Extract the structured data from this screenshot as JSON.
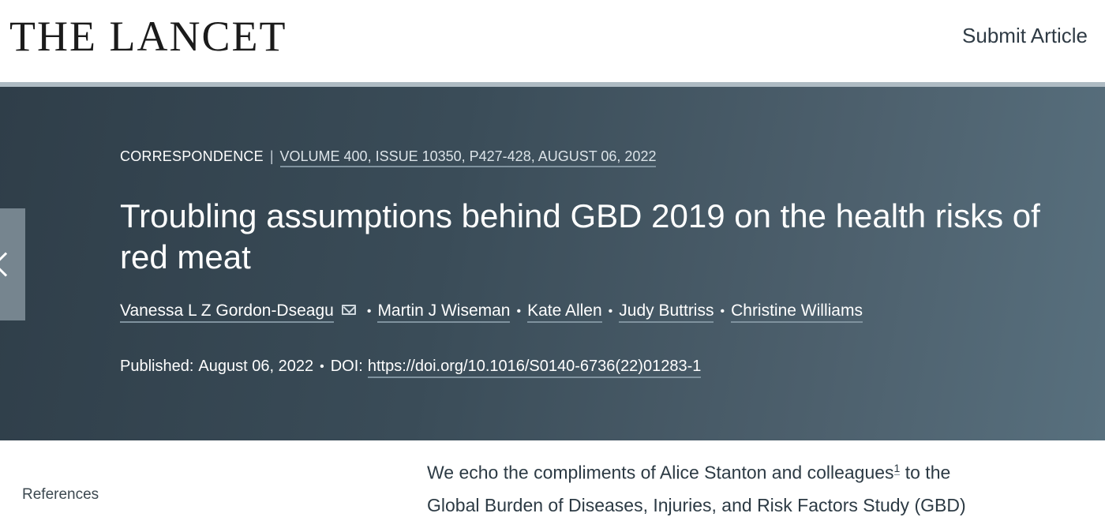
{
  "header": {
    "logo_text": "THE LANCET",
    "submit_label": "Submit Article"
  },
  "hero": {
    "article_type": "CORRESPONDENCE",
    "separator": "|",
    "issue_info": "VOLUME 400, ISSUE 10350, P427-428, AUGUST 06, 2022",
    "title": "Troubling assumptions behind GBD 2019 on the health risks of red meat",
    "authors": [
      "Vanessa L Z Gordon-Dseagu",
      "Martin J Wiseman",
      "Kate Allen",
      "Judy Buttriss",
      "Christine Williams"
    ],
    "published_label": "Published:",
    "published_date": "August 06, 2022",
    "doi_label": "DOI:",
    "doi_url": "https://doi.org/10.1016/S0140-6736(22)01283-1"
  },
  "sidebar": {
    "references_label": "References"
  },
  "body": {
    "line1_before": "We echo the compliments of Alice Stanton and colleagues",
    "ref_num": "1",
    "line1_after": " to the",
    "line2": "Global Burden of Diseases, Injuries, and Risk Factors Study (GBD)"
  },
  "colors": {
    "hero_bg": "#3a4c58",
    "divider": "#aebbc3",
    "side_tab": "#76858f"
  },
  "icons": [
    "chevron-left-icon",
    "mail-icon"
  ]
}
